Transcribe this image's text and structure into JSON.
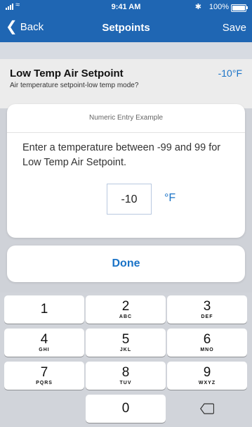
{
  "status_bar": {
    "time": "9:41 AM",
    "battery": "100%",
    "bluetooth_glyph": "✱"
  },
  "nav": {
    "back_label": "Back",
    "title": "Setpoints",
    "save_label": "Save"
  },
  "setting": {
    "title": "Low Temp Air Setpoint",
    "value": "-10°F",
    "description": "Air temperature setpoint-low temp mode?"
  },
  "modal": {
    "header": "Numeric Entry Example",
    "message": "Enter a temperature between -99 and 99 for Low Temp Air Setpoint.",
    "input_value": "-10",
    "unit": "°F"
  },
  "done_label": "Done",
  "keypad": {
    "keys": [
      {
        "digit": "1",
        "letters": ""
      },
      {
        "digit": "2",
        "letters": "ABC"
      },
      {
        "digit": "3",
        "letters": "DEF"
      },
      {
        "digit": "4",
        "letters": "GHI"
      },
      {
        "digit": "5",
        "letters": "JKL"
      },
      {
        "digit": "6",
        "letters": "MNO"
      },
      {
        "digit": "7",
        "letters": "PQRS"
      },
      {
        "digit": "8",
        "letters": "TUV"
      },
      {
        "digit": "9",
        "letters": "WXYZ"
      },
      {
        "digit": "0",
        "letters": ""
      }
    ]
  },
  "colors": {
    "nav_bar": "#1f66b3",
    "accent": "#1a73c7",
    "keypad_bg": "#d1d4da"
  }
}
